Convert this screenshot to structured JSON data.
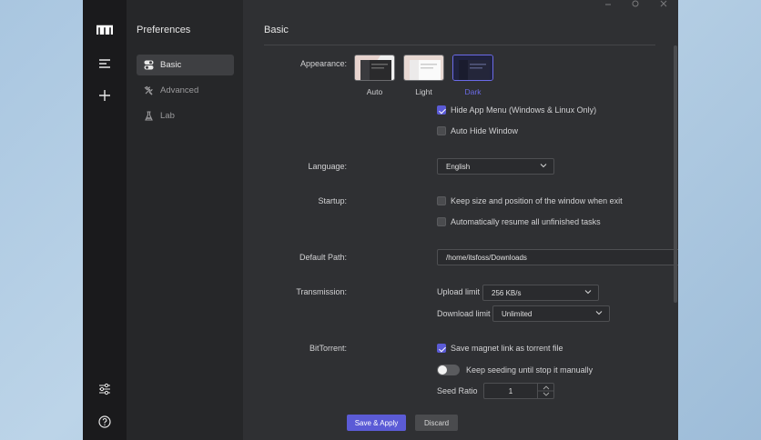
{
  "sidebar": {
    "title": "Preferences",
    "items": [
      {
        "label": "Basic",
        "icon": "toggle-icon",
        "active": true
      },
      {
        "label": "Advanced",
        "icon": "tools-icon",
        "active": false
      },
      {
        "label": "Lab",
        "icon": "flask-icon",
        "active": false
      }
    ]
  },
  "iconbar": {
    "logo": "motrix-logo-icon",
    "items": [
      "menu-list-icon",
      "add-icon"
    ],
    "bottom": [
      "settings-sliders-icon",
      "help-icon"
    ]
  },
  "window_controls": [
    "minimize",
    "maximize",
    "close"
  ],
  "main": {
    "title": "Basic",
    "appearance": {
      "label": "Appearance:",
      "themes": [
        {
          "label": "Auto",
          "selected": false
        },
        {
          "label": "Light",
          "selected": false
        },
        {
          "label": "Dark",
          "selected": true
        }
      ],
      "hide_app_menu": {
        "label": "Hide App Menu (Windows & Linux Only)",
        "checked": true
      },
      "auto_hide_window": {
        "label": "Auto Hide Window",
        "checked": false
      }
    },
    "language": {
      "label": "Language:",
      "value": "English"
    },
    "startup": {
      "label": "Startup:",
      "keep_size": {
        "label": "Keep size and position of the window when exit",
        "checked": false
      },
      "auto_resume": {
        "label": "Automatically resume all unfinished tasks",
        "checked": false
      }
    },
    "default_path": {
      "label": "Default Path:",
      "value": "/home/itsfoss/Downloads"
    },
    "transmission": {
      "label": "Transmission:",
      "upload_label": "Upload limit",
      "upload_value": "256 KB/s",
      "download_label": "Download limit",
      "download_value": "Unlimited"
    },
    "bittorrent": {
      "label": "BitTorrent:",
      "save_magnet": {
        "label": "Save magnet link as torrent file",
        "checked": true
      },
      "keep_seeding": {
        "label": "Keep seeding until stop it manually",
        "on": false
      },
      "seed_ratio_label": "Seed Ratio",
      "seed_ratio_value": "1"
    },
    "buttons": {
      "save": "Save & Apply",
      "discard": "Discard"
    }
  },
  "colors": {
    "accent": "#5b5bd6",
    "background": "#2f3033",
    "sidebar": "#262729",
    "iconbar": "#1a1a1c"
  }
}
